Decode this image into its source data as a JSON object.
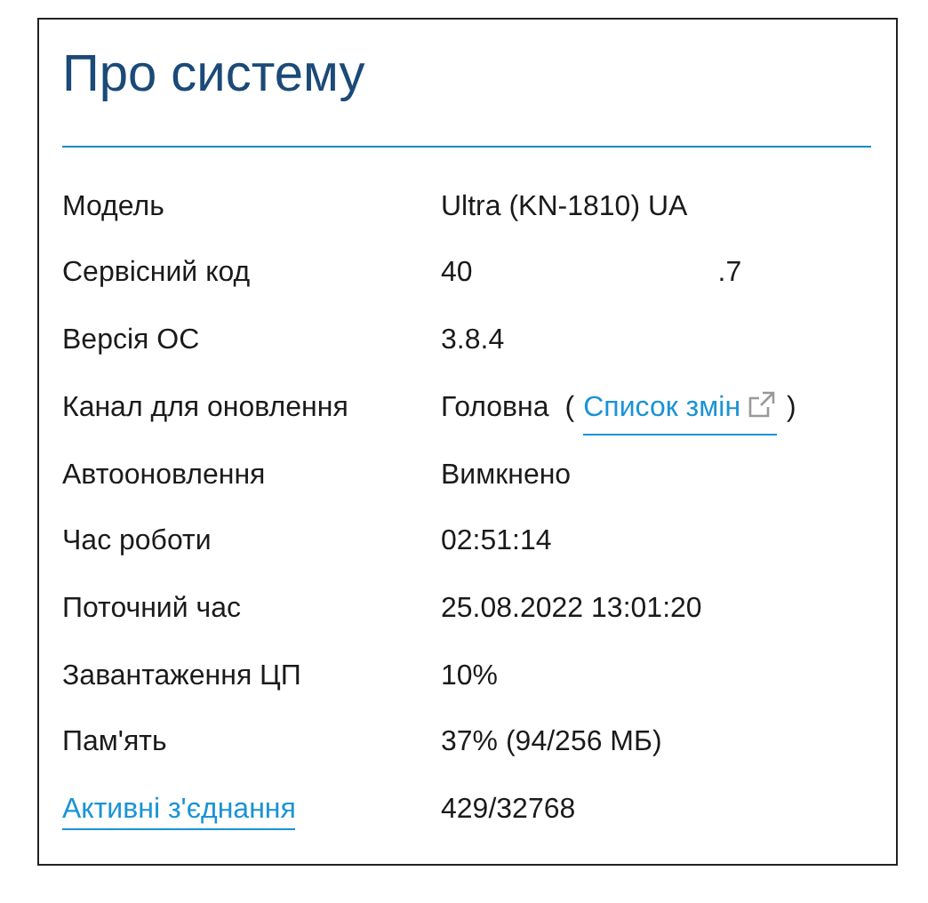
{
  "title": "Про систему",
  "rows": [
    {
      "kind": "plain",
      "label": "Модель",
      "value": "Ultra (KN-1810) UA"
    },
    {
      "kind": "split",
      "label": "Сервісний код",
      "value": "40",
      "value_end": ".7"
    },
    {
      "kind": "plain",
      "label": "Версія ОС",
      "value": "3.8.4"
    },
    {
      "kind": "with_link",
      "label": "Канал для оновлення",
      "value": "Головна",
      "open": "(",
      "link": "Список змін",
      "close": ")"
    },
    {
      "kind": "plain",
      "label": "Автооновлення",
      "value": "Вимкнено"
    },
    {
      "kind": "plain",
      "label": "Час роботи",
      "value": "02:51:14"
    },
    {
      "kind": "plain",
      "label": "Поточний час",
      "value": "25.08.2022 13:01:20"
    },
    {
      "kind": "plain",
      "label": "Завантаження ЦП",
      "value": "10%"
    },
    {
      "kind": "plain",
      "label": "Пам'ять",
      "value": "37% (94/256 МБ)"
    },
    {
      "kind": "link_label",
      "label": "Активні з'єднання",
      "value": "429/32768"
    }
  ]
}
